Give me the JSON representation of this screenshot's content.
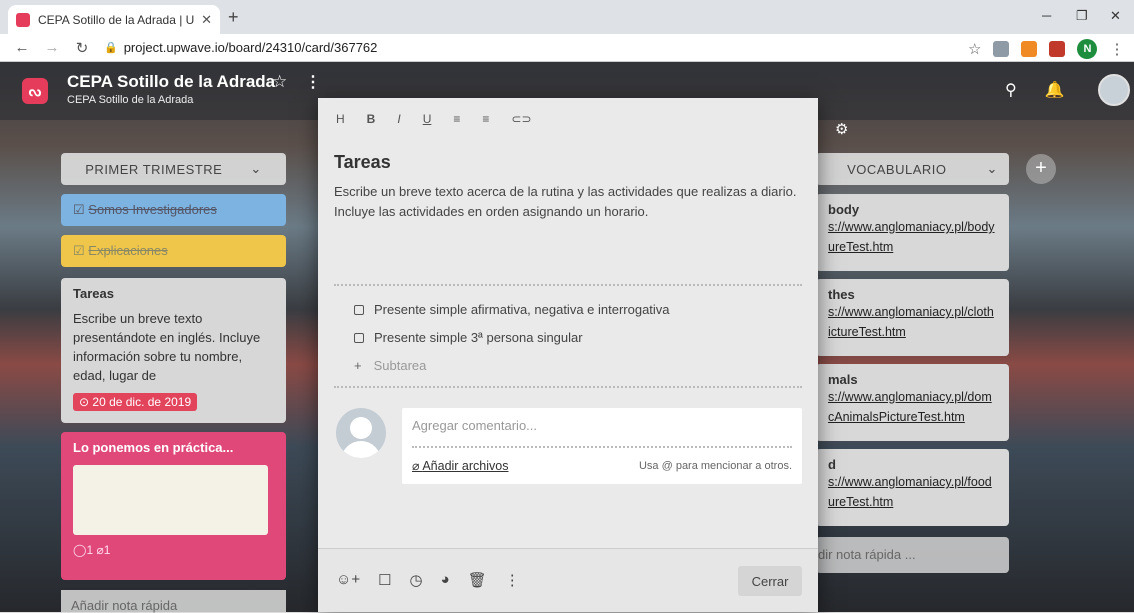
{
  "browser": {
    "tab_title": "CEPA Sotillo de la Adrada | Upwa",
    "url": "project.upwave.io/board/24310/card/367762",
    "profile_initial": "N"
  },
  "board": {
    "title": "CEPA Sotillo de la Adrada",
    "subtitle": "CEPA Sotillo de la Adrada"
  },
  "left_column": {
    "header": "PRIMER TRIMESTRE",
    "cards": [
      {
        "title": "Somos Investigadores"
      },
      {
        "title": "Explicaciones"
      },
      {
        "title": "Tareas",
        "body": "Escribe un breve texto presentándote en inglés. Incluye información sobre tu nombre, edad, lugar de",
        "date": "20 de dic. de 2019"
      },
      {
        "title": "Lo ponemos en práctica...",
        "comments": "1",
        "attachments": "1"
      }
    ],
    "quick_note": "Añadir nota rápida"
  },
  "right_column": {
    "header": "VOCABULARIO",
    "cards": [
      {
        "title": "body",
        "link": "s://www.anglomaniacy.pl/body",
        "link2": "ureTest.htm"
      },
      {
        "title": "thes",
        "link": "s://www.anglomaniacy.pl/cloth",
        "link2": "ictureTest.htm"
      },
      {
        "title": "mals",
        "link": "s://www.anglomaniacy.pl/dom",
        "link2": "cAnimalsPictureTest.htm"
      },
      {
        "title": "d",
        "link": "s://www.anglomaniacy.pl/food",
        "link2": "ureTest.htm"
      }
    ],
    "quick_note": "dir nota rápida ..."
  },
  "modal": {
    "toolbar": [
      "H",
      "B",
      "I",
      "U",
      "≡",
      "≡",
      "⊂⊃"
    ],
    "title": "Tareas",
    "description": "Escribe un breve texto acerca de la rutina y las actividades que realizas a diario. Incluye las actividades en orden asignando un horario.",
    "subtasks": [
      "Presente simple afirmativa, negativa e interrogativa",
      "Presente simple 3ª persona singular"
    ],
    "add_subtask": "Subtarea",
    "comment_placeholder": "Agregar comentario...",
    "attach_label": "Añadir archivos",
    "mention_hint": "Usa @ para mencionar a otros.",
    "close_label": "Cerrar"
  },
  "colors": {
    "accent": "#e63c5c",
    "badge": "#e2445c"
  }
}
